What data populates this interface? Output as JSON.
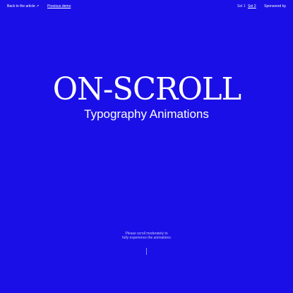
{
  "header": {
    "back_link": "Back to the article ↗",
    "previous_demo": "Previous demo",
    "set_1": "Set 1",
    "set_2": "Set 2",
    "sponsored_by": "Sponsored by"
  },
  "hero": {
    "title": "ON-SCROLL",
    "subtitle": "Typography Animations"
  },
  "scroll_hint": {
    "text": "Please scroll moderately to fully experience the animations"
  },
  "colors": {
    "background": "#1a0fe6",
    "text": "#ffffff"
  }
}
